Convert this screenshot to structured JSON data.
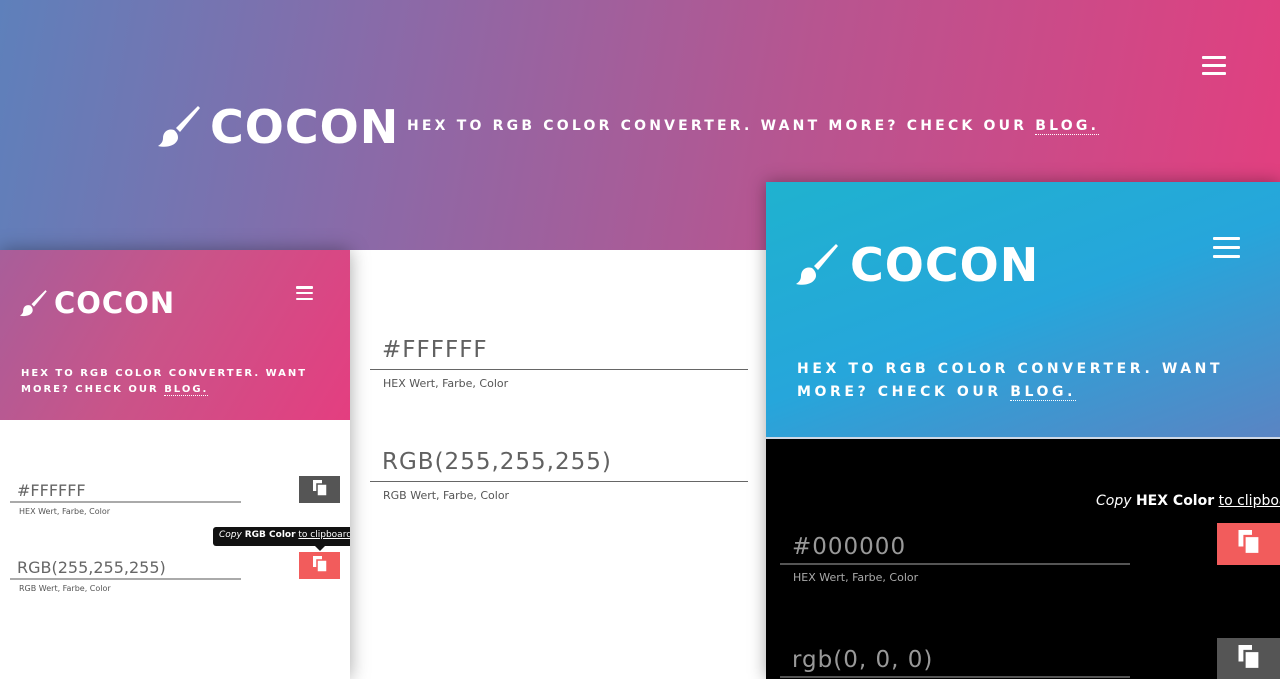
{
  "hero": {
    "brand": "COCON",
    "tagline_prefix": "Hex to RGB color converter. Want more? Check our ",
    "blog_link": "blog."
  },
  "center": {
    "hex_value": "#FFFFFF",
    "hex_hint": "HEX Wert, Farbe, Color",
    "rgb_value": "RGB(255,255,255)",
    "rgb_hint": "RGB Wert, Farbe, Color"
  },
  "left_mockup": {
    "brand": "COCON",
    "tagline_prefix": "Hex to RGB color converter. Want more? Check our ",
    "blog_link": "blog.",
    "hex_value": "#FFFFFF",
    "hex_hint": "HEX Wert, Farbe, Color",
    "rgb_value": "RGB(255,255,255)",
    "rgb_hint": "RGB Wert, Farbe, Color",
    "tooltip": {
      "copy": "Copy",
      "target": "RGB Color",
      "suffix": "to clipboard"
    },
    "hex_button_color": "#555555",
    "rgb_button_color": "#f25c5c"
  },
  "right_mockup": {
    "brand": "COCON",
    "tagline_prefix": "Hex to RGB color converter. Want more? Check our ",
    "blog_link": "blog.",
    "tooltip": {
      "copy": "Copy",
      "target": "HEX Color",
      "suffix": "to clipboard"
    },
    "hex_value": "#000000",
    "hex_hint": "HEX Wert, Farbe, Color",
    "rgb_value": "rgb(0, 0, 0)",
    "hex_button_color": "#f25c5c",
    "rgb_button_color": "#555555"
  },
  "icons": {
    "brush": "paint-brush-icon",
    "menu": "hamburger-menu-icon",
    "copy": "clipboard-copy-icon"
  }
}
